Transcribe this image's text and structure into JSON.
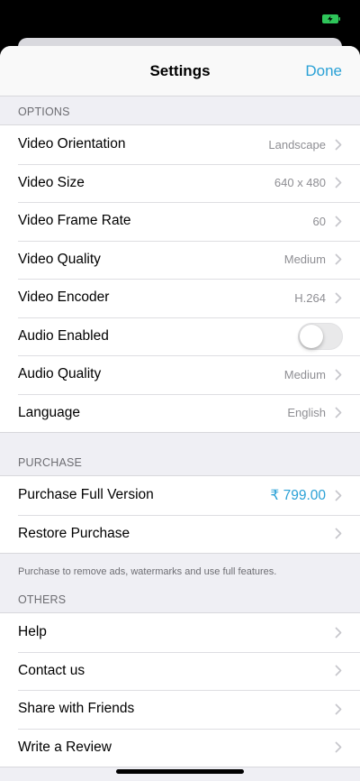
{
  "nav": {
    "title": "Settings",
    "done_label": "Done"
  },
  "sections": {
    "options": {
      "header": "OPTIONS",
      "rows": {
        "video_orientation": {
          "label": "Video Orientation",
          "value": "Landscape"
        },
        "video_size": {
          "label": "Video Size",
          "value": "640 x 480"
        },
        "video_frame_rate": {
          "label": "Video Frame Rate",
          "value": "60"
        },
        "video_quality": {
          "label": "Video Quality",
          "value": "Medium"
        },
        "video_encoder": {
          "label": "Video Encoder",
          "value": "H.264"
        },
        "audio_enabled": {
          "label": "Audio Enabled",
          "toggle_on": false
        },
        "audio_quality": {
          "label": "Audio Quality",
          "value": "Medium"
        },
        "language": {
          "label": "Language",
          "value": "English"
        }
      }
    },
    "purchase": {
      "header": "PURCHASE",
      "rows": {
        "full_version": {
          "label": "Purchase Full Version",
          "value": "₹ 799.00"
        },
        "restore": {
          "label": "Restore Purchase"
        }
      },
      "footer": "Purchase to remove ads, watermarks and use full features."
    },
    "others": {
      "header": "OTHERS",
      "rows": {
        "help": {
          "label": "Help"
        },
        "contact": {
          "label": "Contact us"
        },
        "share": {
          "label": "Share with Friends"
        },
        "review": {
          "label": "Write a Review"
        }
      }
    }
  },
  "colors": {
    "accent": "#2aa1d6",
    "secondary_text": "#8e8e93",
    "background": "#efeff4",
    "battery": "#2ec55a"
  },
  "icons": {
    "battery": "battery-charging-icon",
    "disclosure": "chevron-right-icon"
  }
}
